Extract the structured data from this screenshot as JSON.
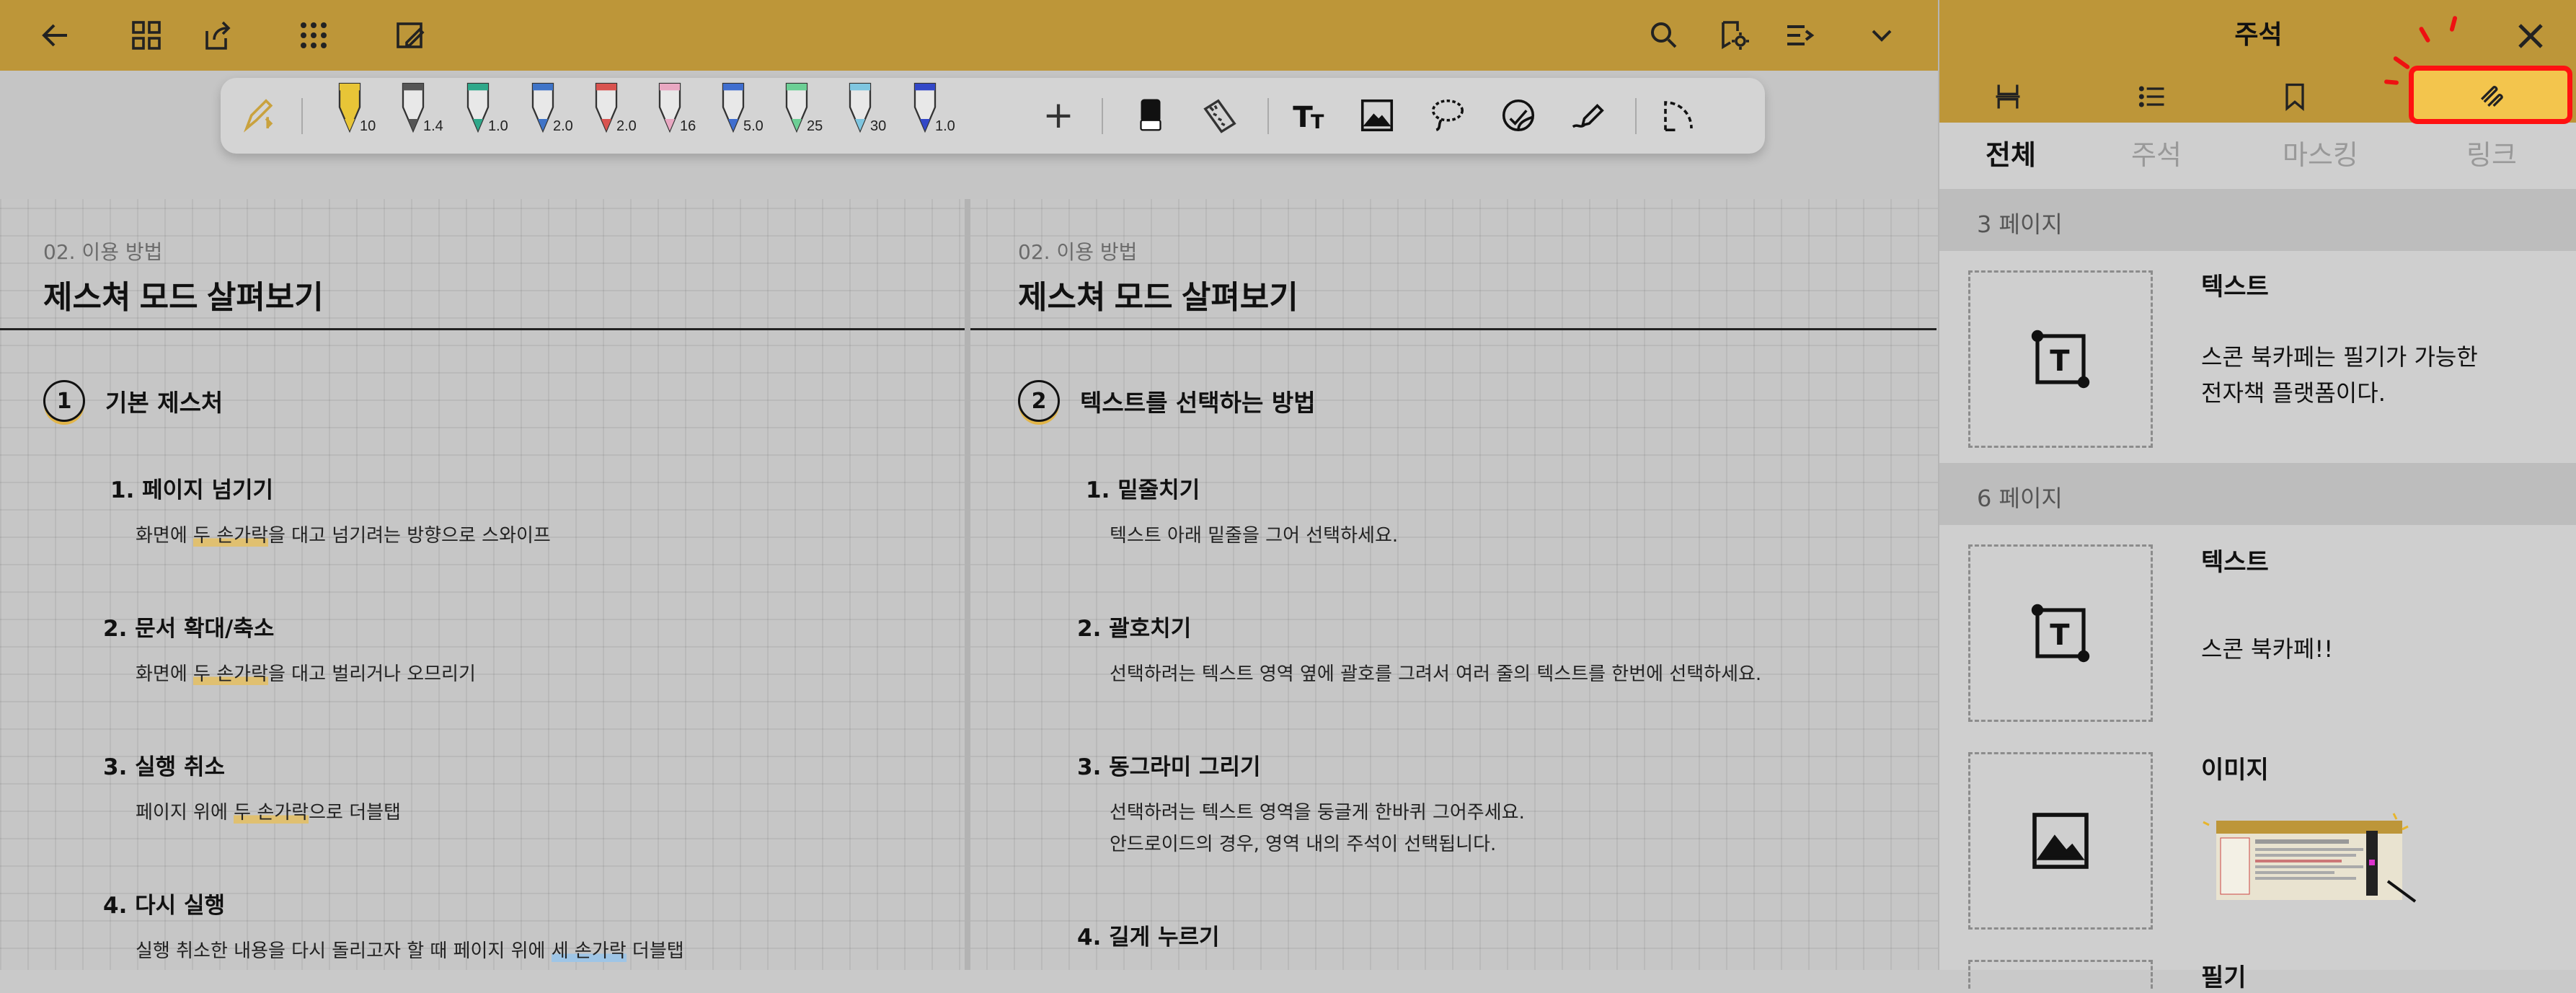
{
  "toolbar": {
    "icons": [
      "back-arrow-icon",
      "grid-icon",
      "share-upload-icon",
      "apps-dots-icon",
      "edit-mode-icon",
      "search-icon",
      "bookmark-settings-icon",
      "reading-list-icon",
      "chevron-down-icon"
    ]
  },
  "pen_tools": {
    "sizes": [
      "10",
      "1.4",
      "1.0",
      "2.0",
      "2.0",
      "16",
      "5.0",
      "25",
      "30",
      "1.0"
    ],
    "colors": [
      "#e8c537",
      "#555555",
      "#2fa88a",
      "#3f74c8",
      "#d9534f",
      "#e9a8c2",
      "#3f6ecf",
      "#6ccf95",
      "#7fc6e0",
      "#3348c8"
    ],
    "add_label": "+"
  },
  "left_page": {
    "crumb": "02. 이용 방법",
    "title": "제스쳐 모드 살펴보기",
    "section_num": "1",
    "section_title": "기본 제스처",
    "items": [
      {
        "heading": "1. 페이지 넘기기",
        "pre": "화면에 ",
        "hl": "두 손가락",
        "post": "을 대고 넘기려는 방향으로 스와이프"
      },
      {
        "heading": "2. 문서 확대/축소",
        "pre": "화면에 ",
        "hl": "두 손가락",
        "post": "을 대고 벌리거나 오므리기"
      },
      {
        "heading": "3. 실행 취소",
        "pre": "페이지 위에 ",
        "hl": "두 손가락",
        "post": "으로 더블탭"
      },
      {
        "heading": "4. 다시 실행",
        "pre": "실행 취소한 내용을 다시 돌리고자 할 때 페이지 위에 ",
        "hl": "세 손가락",
        "post": " 더블탭"
      }
    ]
  },
  "right_page": {
    "crumb": "02. 이용 방법",
    "title": "제스쳐 모드 살펴보기",
    "section_num": "2",
    "section_title": "텍스트를 선택하는 방법",
    "items": [
      {
        "heading": "1. 밑줄치기",
        "text": "텍스트 아래 밑줄을 그어 선택하세요."
      },
      {
        "heading": "2. 괄호치기",
        "text": "선택하려는 텍스트 영역 옆에 괄호를 그려서 여러 줄의 텍스트를 한번에 선택하세요."
      },
      {
        "heading": "3. 동그라미 그리기",
        "text": "선택하려는 텍스트 영역을 둥글게 한바퀴 그어주세요.",
        "text2": "안드로이드의 경우, 영역 내의 주석이 선택됩니다."
      },
      {
        "heading": "4. 길게 누르기"
      }
    ]
  },
  "panel": {
    "title": "주석",
    "tabs": [
      "page-thumbnails-icon",
      "toc-list-icon",
      "bookmark-icon",
      "annotation-pen-icon"
    ],
    "filters": [
      "전체",
      "주석",
      "마스킹",
      "링크"
    ],
    "groups": [
      {
        "label": "3 페이지"
      },
      {
        "label": "6 페이지"
      }
    ],
    "entries": [
      {
        "type": "텍스트",
        "text1": "스콘 북카페는 필기가 가능한",
        "text2": "전자책 플랫폼이다."
      },
      {
        "type": "텍스트",
        "text1": "스콘 북카페!!"
      },
      {
        "type": "이미지"
      }
    ],
    "next_entry_partial": "필기"
  }
}
